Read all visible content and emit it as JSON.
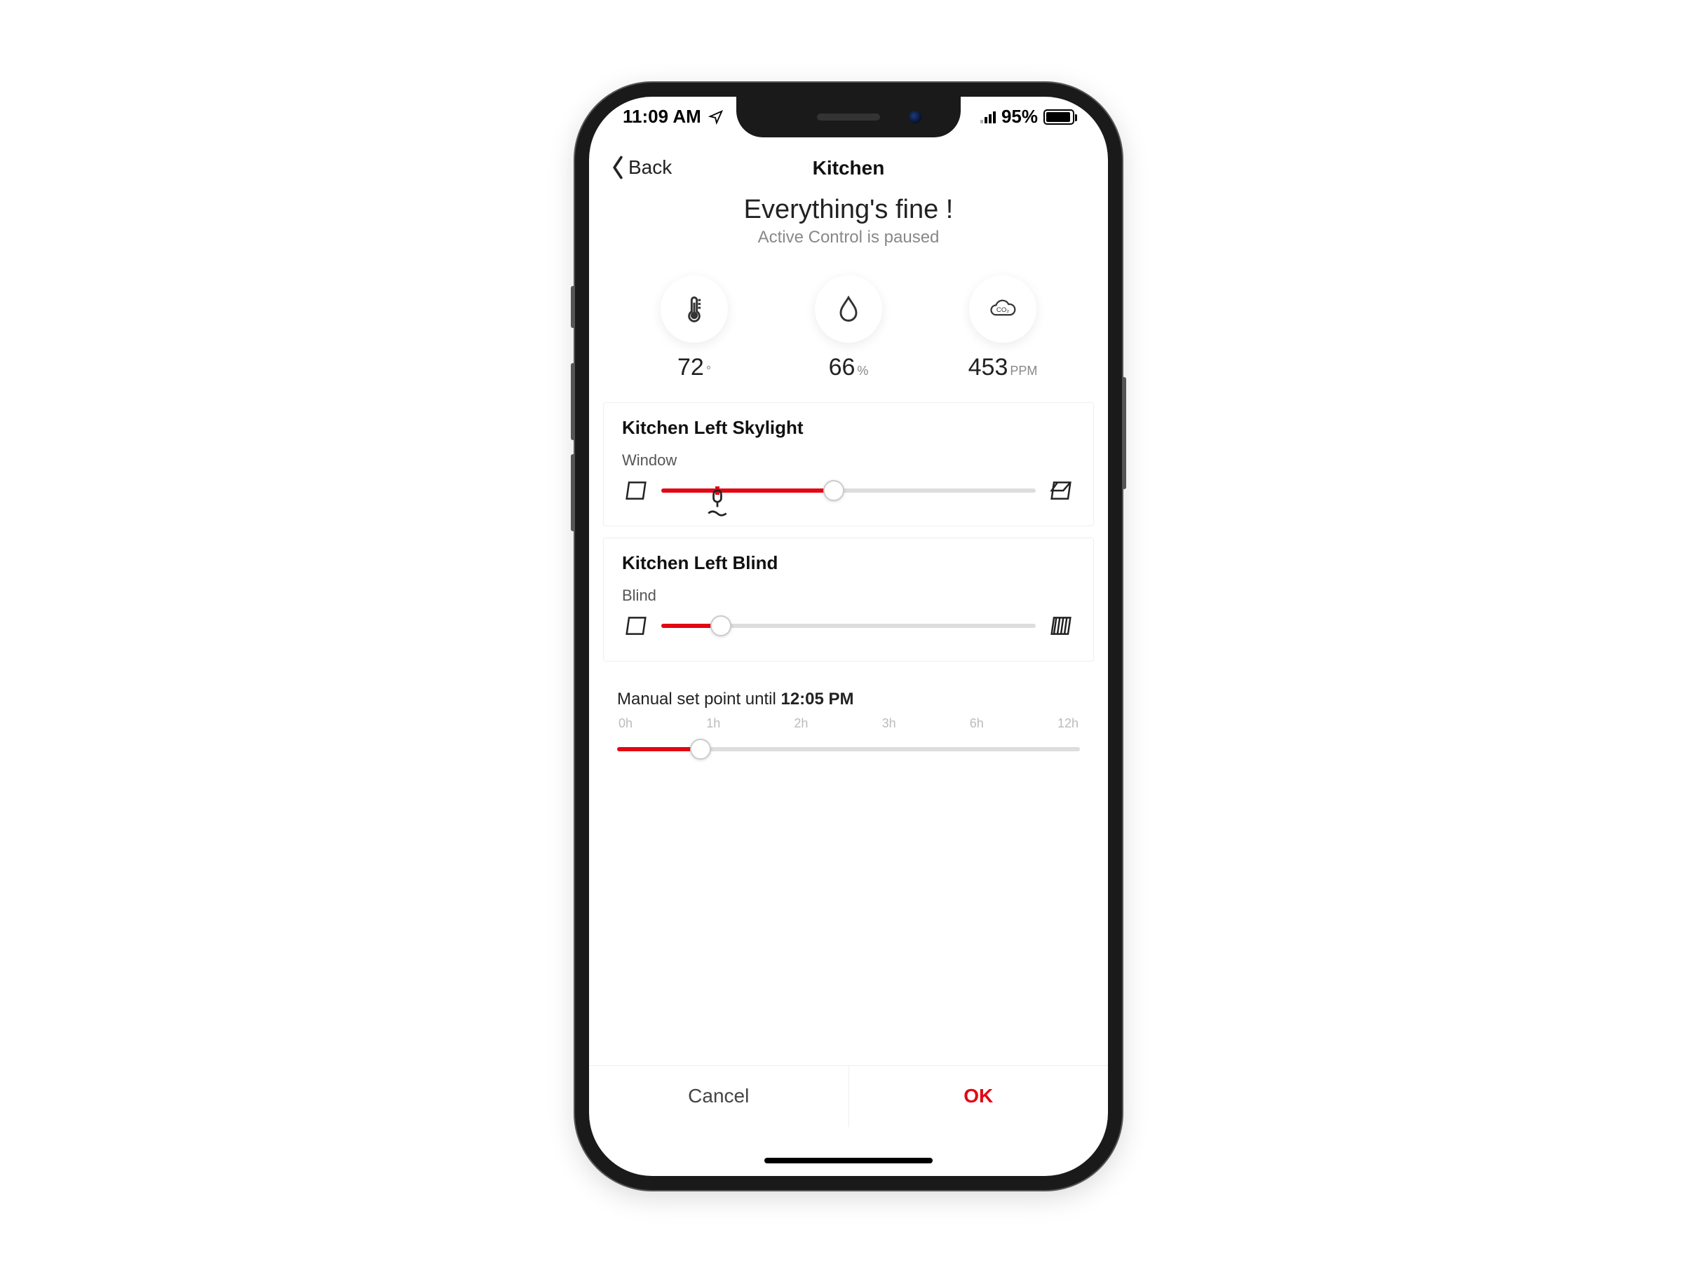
{
  "status_bar": {
    "time": "11:09 AM",
    "battery_pct": "95%"
  },
  "header": {
    "back_label": "Back",
    "title": "Kitchen"
  },
  "summary": {
    "headline": "Everything's fine !",
    "subtext": "Active Control is paused"
  },
  "metrics": {
    "temperature": {
      "value": "72",
      "unit": "°"
    },
    "humidity": {
      "value": "66",
      "unit": "%"
    },
    "co2": {
      "value": "453",
      "unit": "PPM"
    }
  },
  "devices": [
    {
      "title": "Kitchen Left Skylight",
      "sub": "Window",
      "slider_pct": 46,
      "mark_pct": 15,
      "has_rain_mark": true
    },
    {
      "title": "Kitchen Left Blind",
      "sub": "Blind",
      "slider_pct": 16,
      "mark_pct": null,
      "has_rain_mark": false
    }
  ],
  "setpoint": {
    "label_prefix": "Manual set point until ",
    "time": "12:05 PM",
    "ticks": [
      "0h",
      "1h",
      "2h",
      "3h",
      "6h",
      "12h"
    ],
    "slider_pct": 18
  },
  "buttons": {
    "cancel": "Cancel",
    "ok": "OK"
  },
  "colors": {
    "accent": "#e30613"
  }
}
